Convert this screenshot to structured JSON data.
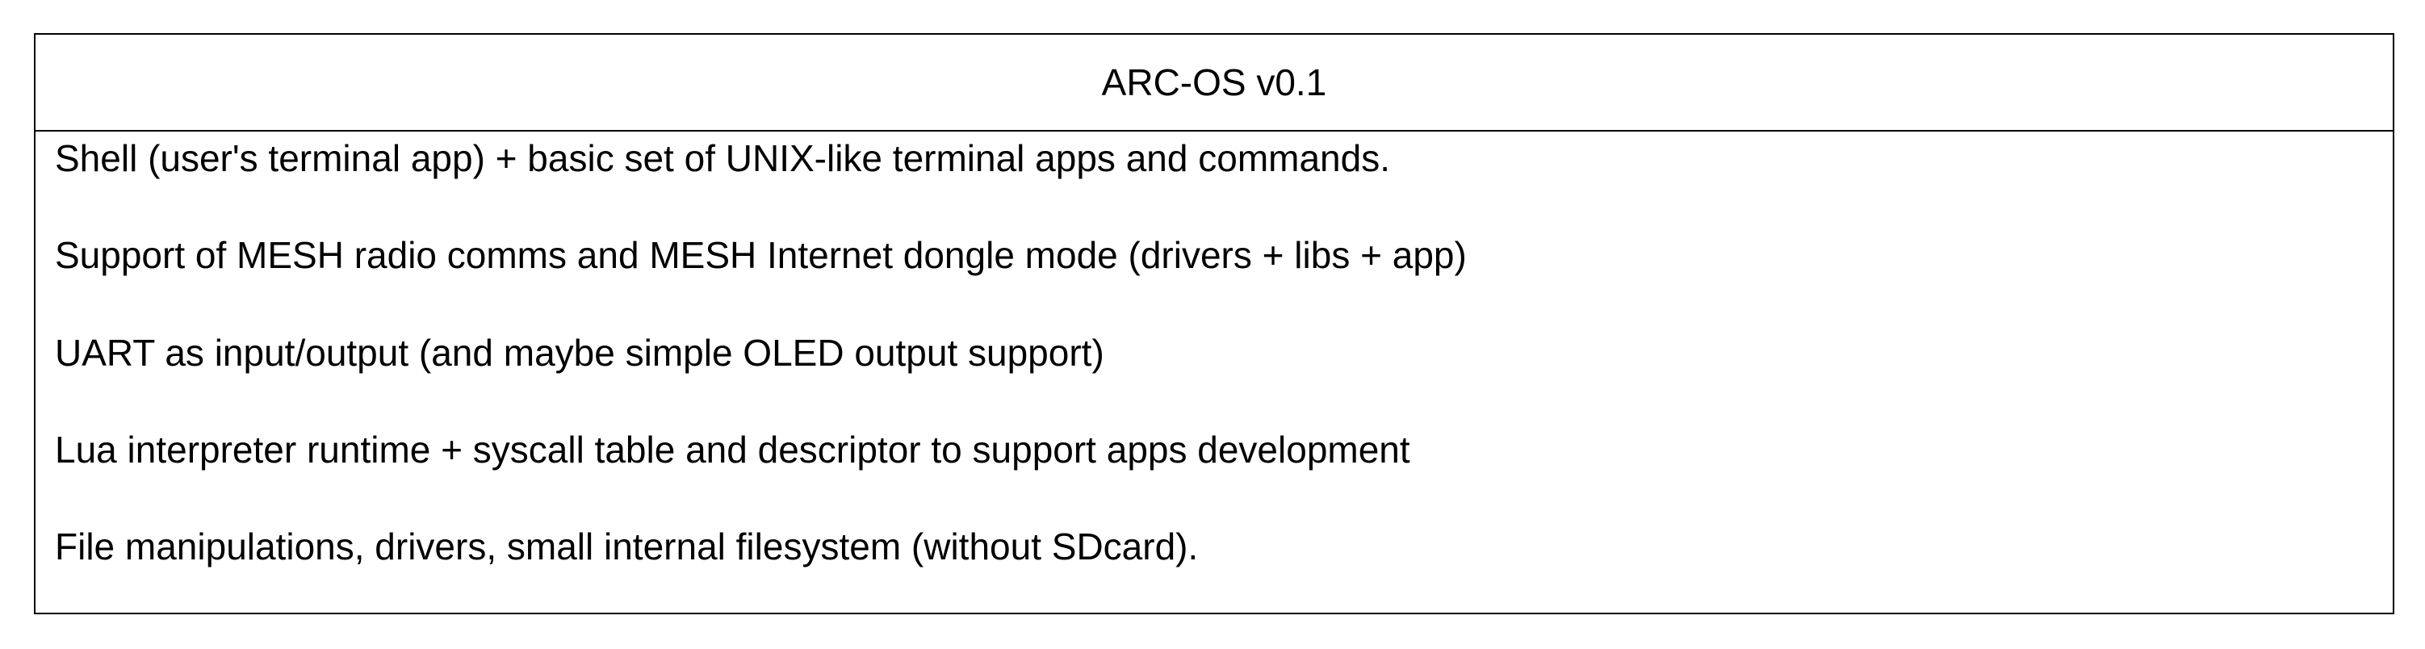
{
  "block": {
    "title": "ARC-OS v0.1",
    "items": [
      "Shell (user's terminal app) + basic set of UNIX-like terminal apps and commands.",
      "Support of MESH radio comms and MESH Internet dongle mode (drivers + libs + app)",
      "UART as input/output (and maybe simple OLED output support)",
      "Lua interpreter runtime + syscall table and descriptor to support apps development",
      "File manipulations, drivers, small internal filesystem (without SDcard)."
    ]
  }
}
